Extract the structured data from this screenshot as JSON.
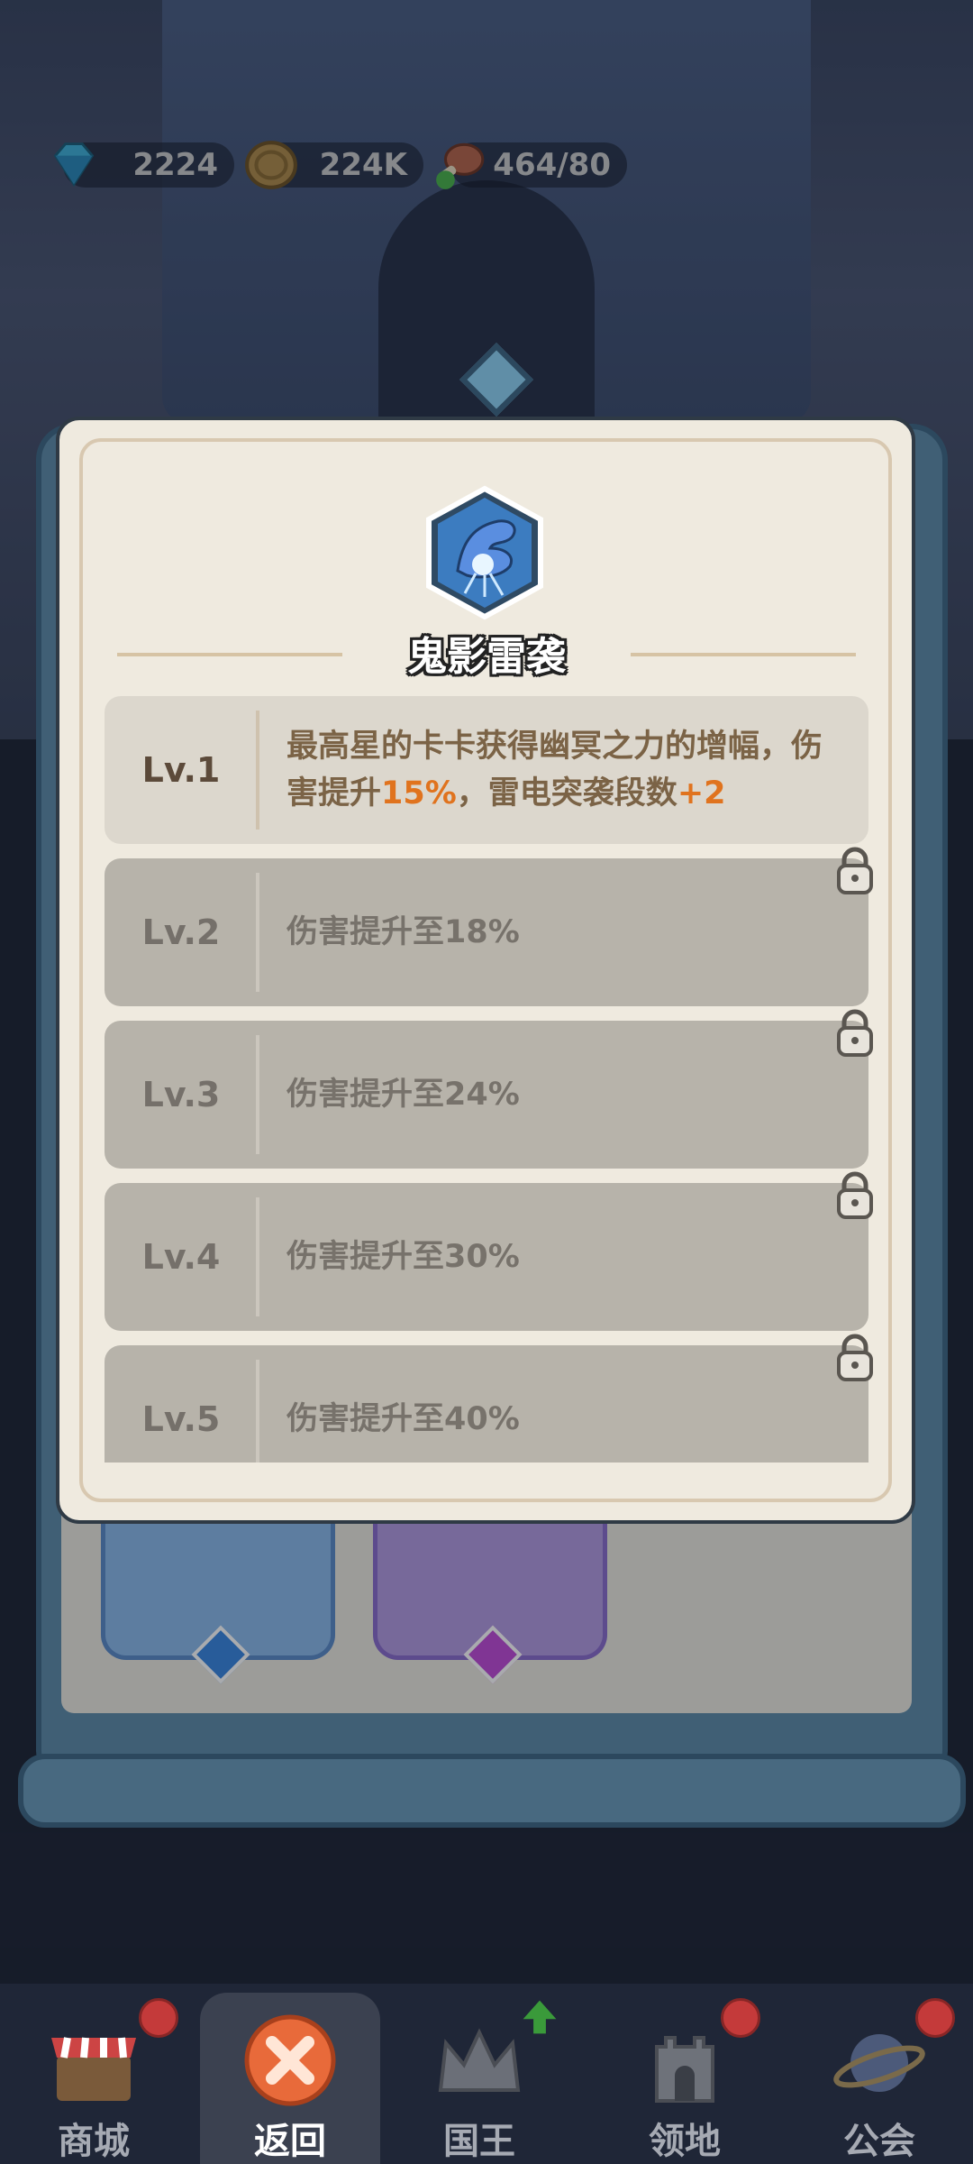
{
  "resources": {
    "diamonds": "2224",
    "coins": "224K",
    "stamina": "464/80"
  },
  "skill": {
    "title": "鬼影雷袭",
    "icon": "hand-lightning-icon"
  },
  "levels": [
    {
      "lv": "Lv.1",
      "desc_pre": "最高星的卡卡获得幽冥之力的增幅，伤害提升",
      "hl1": "15%",
      "desc_mid": "，雷电突袭段数",
      "hl2": "+2",
      "locked": false
    },
    {
      "lv": "Lv.2",
      "desc": "伤害提升至18%",
      "locked": true
    },
    {
      "lv": "Lv.3",
      "desc": "伤害提升至24%",
      "locked": true
    },
    {
      "lv": "Lv.4",
      "desc": "伤害提升至30%",
      "locked": true
    },
    {
      "lv": "Lv.5",
      "desc": "伤害提升至40%",
      "locked": true
    }
  ],
  "nav": {
    "items": [
      {
        "label": "商城",
        "icon": "shop-icon",
        "badge": true
      },
      {
        "label": "返回",
        "icon": "close-icon",
        "selected": true
      },
      {
        "label": "国王",
        "icon": "crown-icon",
        "arrow": true
      },
      {
        "label": "领地",
        "icon": "castle-icon",
        "badge": true
      },
      {
        "label": "公会",
        "icon": "planet-icon",
        "badge": true
      }
    ]
  },
  "colors": {
    "highlight": "#e0731e",
    "active_row": "#dcd7cd",
    "locked_row": "#b7b3aa",
    "frame_blue": "#5e8ba8"
  }
}
